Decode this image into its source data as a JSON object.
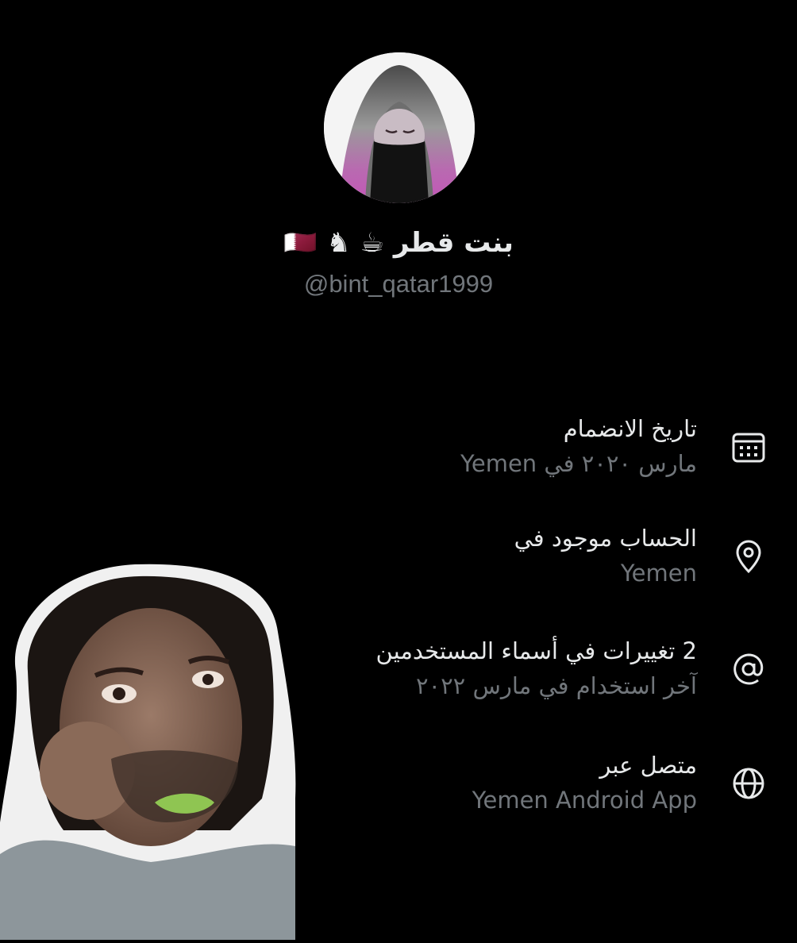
{
  "profile": {
    "display_name": "بنت قطر ☕ ♞ 🇶🇦",
    "handle": "@bint_qatar1999"
  },
  "about": [
    {
      "title": "تاريخ الانضمام",
      "value": "مارس ٢٠٢٠ في Yemen",
      "icon": "calendar-icon"
    },
    {
      "title": "الحساب موجود في",
      "value": "Yemen",
      "icon": "location-pin-icon"
    },
    {
      "title": "2 تغييرات في أسماء المستخدمين",
      "value": "آخر استخدام في مارس ٢٠٢٢",
      "icon": "at-sign-icon"
    },
    {
      "title": "متصل عبر",
      "value": "Yemen Android App",
      "icon": "globe-icon"
    }
  ],
  "colors": {
    "background": "#000000",
    "primary_text": "#e7e9ea",
    "secondary_text": "#71767b"
  }
}
